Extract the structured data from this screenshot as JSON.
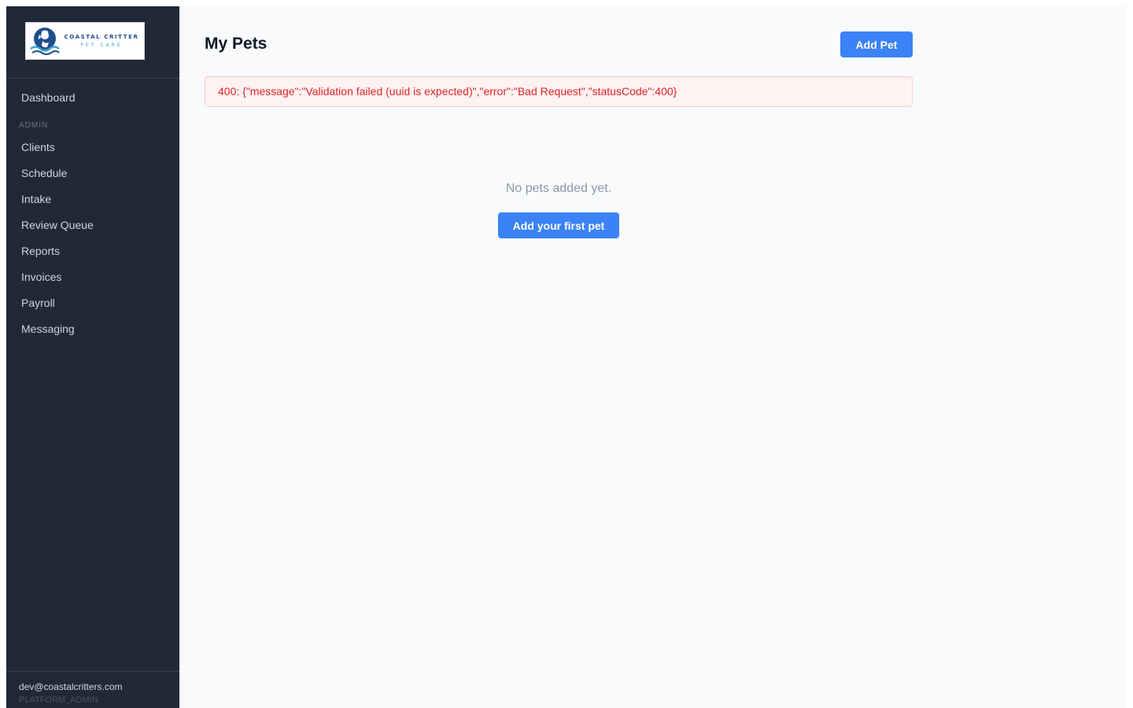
{
  "brand": {
    "name_line1": "COASTAL CRITTER",
    "name_line2": "PET CARE",
    "logo_icon": "dog-wave-logo-icon"
  },
  "sidebar": {
    "dashboard_label": "Dashboard",
    "section_label": "ADMIN",
    "items": [
      {
        "label": "Clients"
      },
      {
        "label": "Schedule"
      },
      {
        "label": "Intake"
      },
      {
        "label": "Review Queue"
      },
      {
        "label": "Reports"
      },
      {
        "label": "Invoices"
      },
      {
        "label": "Payroll"
      },
      {
        "label": "Messaging"
      }
    ],
    "user": {
      "email": "dev@coastalcritters.com",
      "role": "PLATFORM_ADMIN"
    }
  },
  "main": {
    "title": "My Pets",
    "add_pet_label": "Add Pet",
    "error_message": "400: {\"message\":\"Validation failed (uuid is expected)\",\"error\":\"Bad Request\",\"statusCode\":400}",
    "empty_text": "No pets added yet.",
    "add_first_label": "Add your first pet"
  },
  "colors": {
    "sidebar_bg": "#1f2937",
    "accent": "#3b82f6",
    "error_text": "#dc2626",
    "error_bg": "#fef2f2",
    "main_bg": "#f8fafc"
  }
}
